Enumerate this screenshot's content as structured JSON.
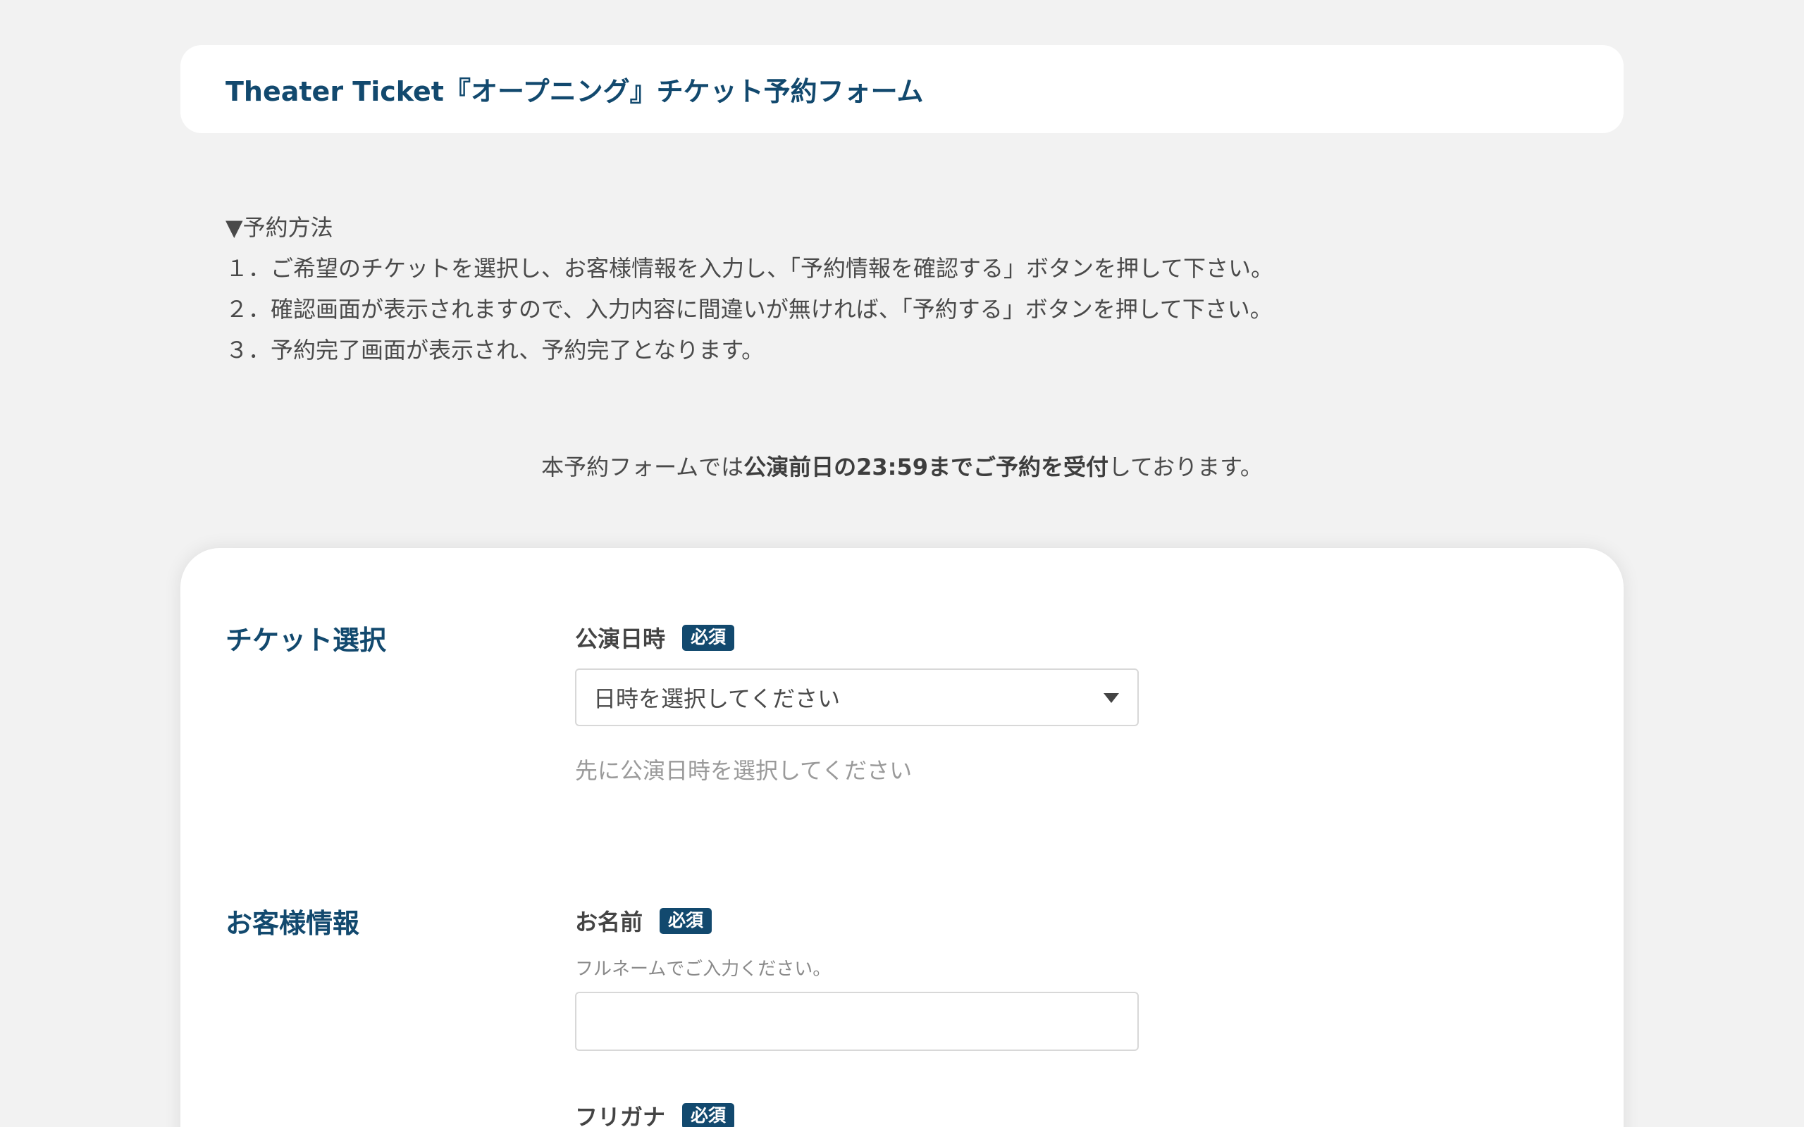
{
  "header": {
    "title": "Theater Ticket『オープニング』チケット予約フォーム"
  },
  "instructions": {
    "heading": "▼予約方法",
    "steps": [
      "１．ご希望のチケットを選択し、お客様情報を入力し、「予約情報を確認する」ボタンを押して下さい。",
      "２．確認画面が表示されますので、入力内容に間違いが無ければ、「予約する」ボタンを押して下さい。",
      "３．予約完了画面が表示され、予約完了となります。"
    ]
  },
  "notice": {
    "prefix": "本予約フォームでは",
    "emphasis": "公演前日の23:59までご予約を受付",
    "suffix": "しております。"
  },
  "ticket_section": {
    "title": "チケット選択",
    "date_label": "公演日時",
    "required_badge": "必須",
    "date_select_value": "日時を選択してください",
    "date_hint": "先に公演日時を選択してください"
  },
  "customer_section": {
    "title": "お客様情報",
    "name_label": "お名前",
    "name_required_badge": "必須",
    "name_hint": "フルネームでご入力ください。",
    "name_value": "",
    "kana_label": "フリガナ",
    "kana_required_badge": "必須"
  },
  "colors": {
    "accent": "#12496e",
    "background": "#f2f2f2",
    "card": "#ffffff"
  },
  "icons": {
    "select_arrow": "caret-down-icon"
  }
}
